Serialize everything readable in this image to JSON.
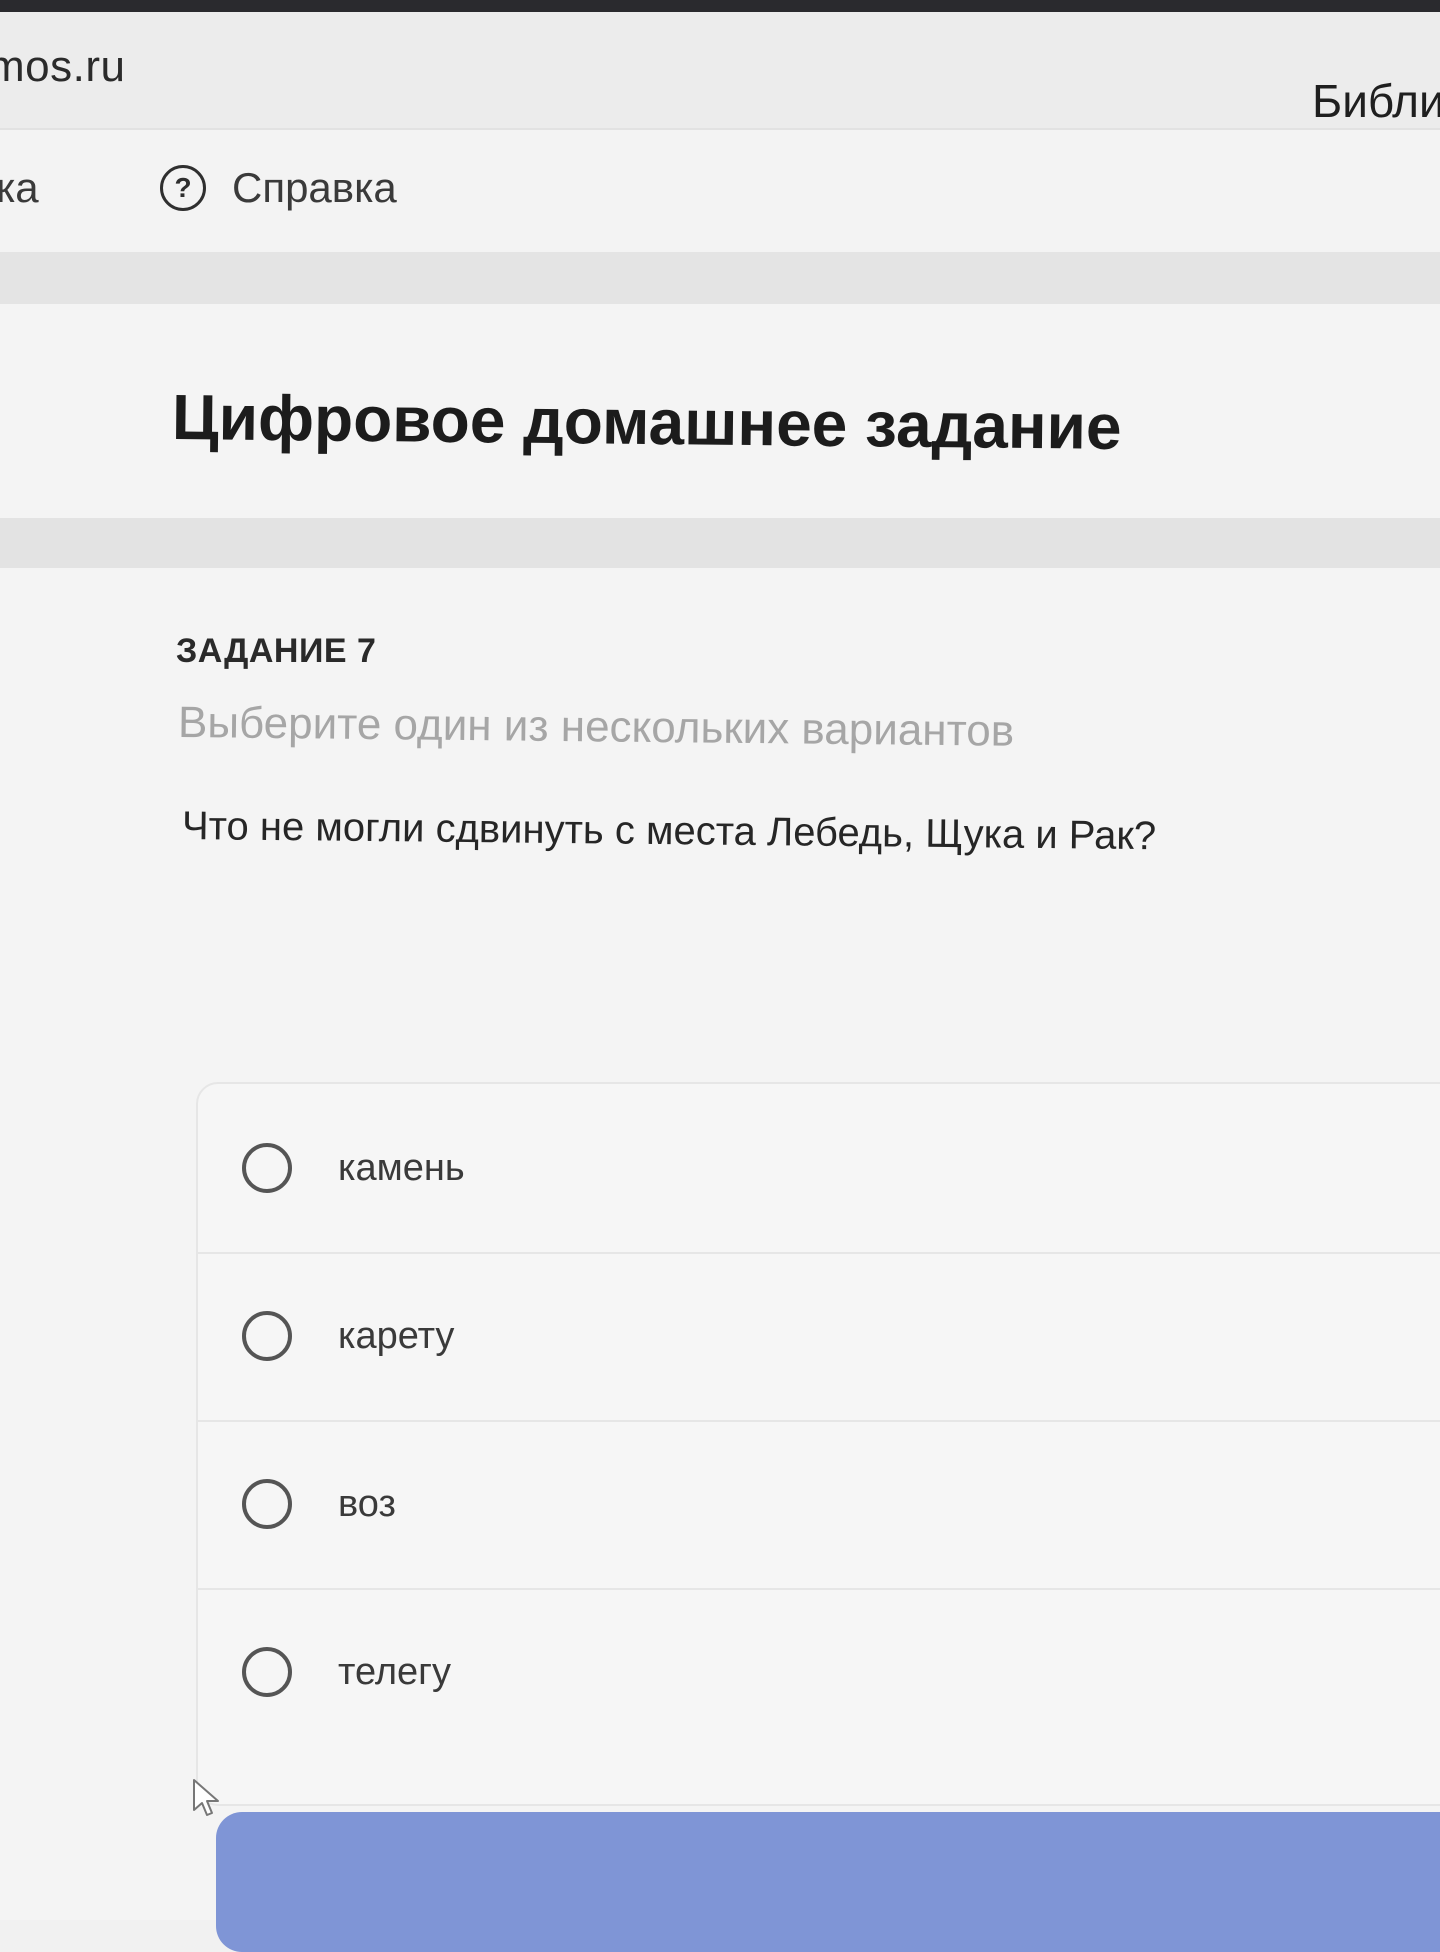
{
  "header": {
    "site": "mos.ru",
    "library_link": "Библи"
  },
  "nav": {
    "left_item": "ка",
    "help_label": "Справка",
    "help_icon_glyph": "?"
  },
  "page": {
    "title": "Цифровое домашнее задание"
  },
  "task": {
    "number": "ЗАДАНИЕ 7",
    "hint": "Выберите один из нескольких вариантов",
    "question": "Что не могли сдвинуть с места Лебедь, Щука и Рак?",
    "options": [
      {
        "label": "камень",
        "selected": false
      },
      {
        "label": "карету",
        "selected": false
      },
      {
        "label": "воз",
        "selected": false
      },
      {
        "label": "телегу",
        "selected": false
      }
    ]
  },
  "colors": {
    "submit_button": "#7f95d6",
    "hint_text": "#a6a6a6"
  },
  "icons": {
    "help": "question-circle-icon",
    "radio": "radio-circle-icon",
    "cursor": "mouse-pointer-icon"
  }
}
